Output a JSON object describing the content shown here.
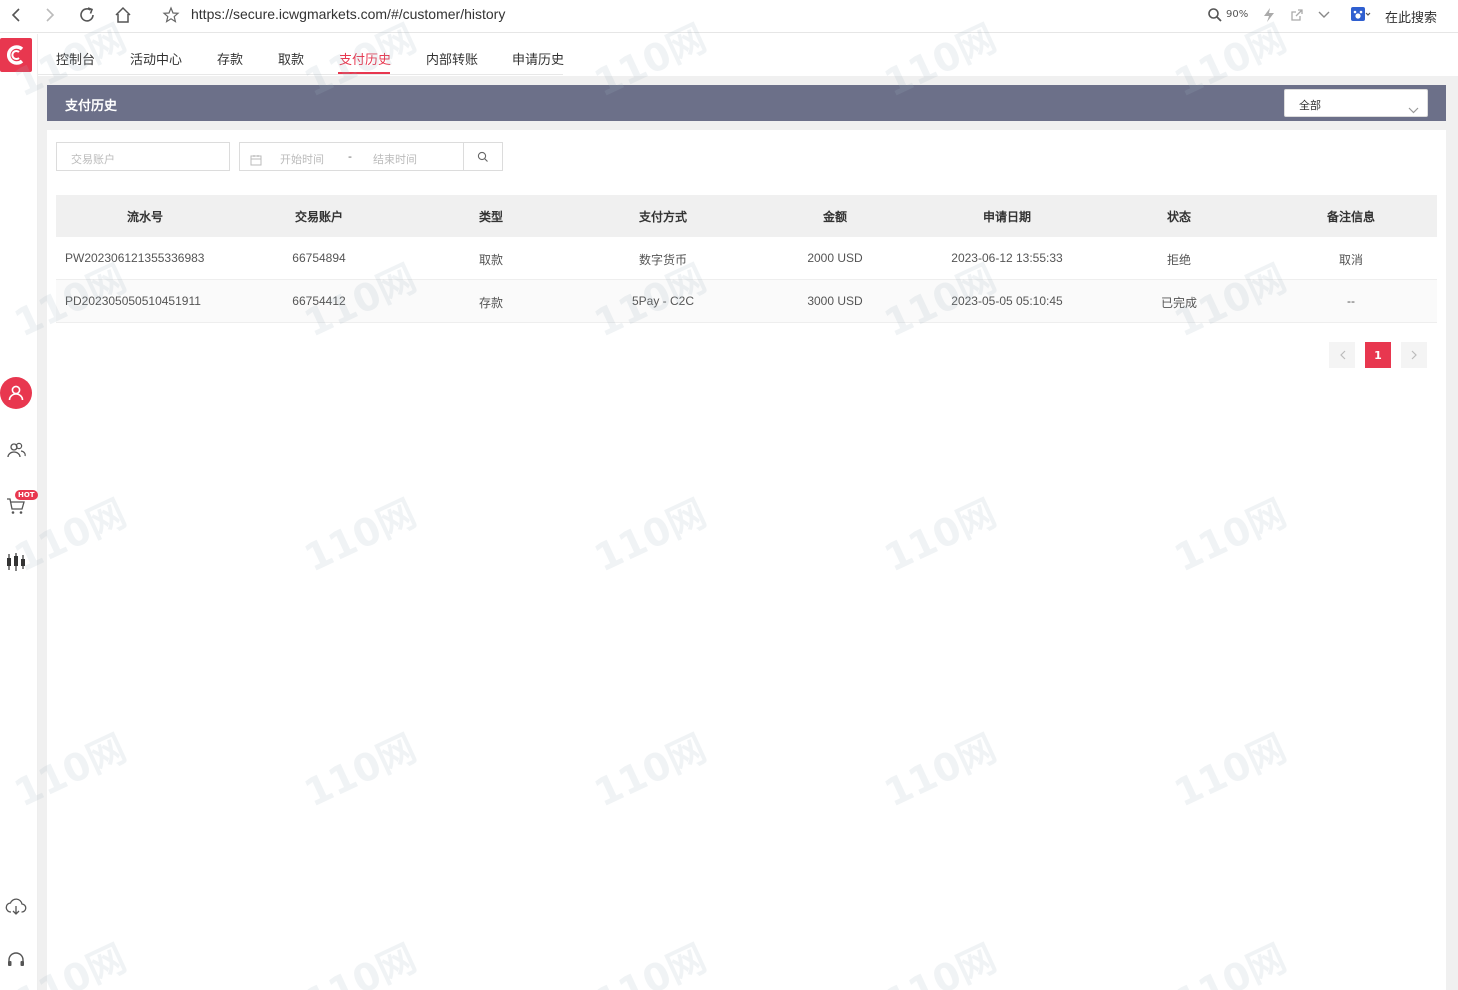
{
  "browser": {
    "url": "https://secure.icwgmarkets.com/#/customer/history",
    "zoom": "90%",
    "search_label": "在此搜索"
  },
  "nav": {
    "tabs": [
      {
        "label": "控制台"
      },
      {
        "label": "活动中心"
      },
      {
        "label": "存款"
      },
      {
        "label": "取款"
      },
      {
        "label": "支付历史"
      },
      {
        "label": "内部转账"
      },
      {
        "label": "申请历史"
      }
    ],
    "active_index": 4
  },
  "sidebar": {
    "hot_badge": "HOT"
  },
  "panel": {
    "title": "支付历史",
    "filter_select": "全部"
  },
  "filters": {
    "account_placeholder": "交易账户",
    "start_placeholder": "开始时间",
    "separator": "-",
    "end_placeholder": "结束时间"
  },
  "table": {
    "headers": [
      "流水号",
      "交易账户",
      "类型",
      "支付方式",
      "金额",
      "申请日期",
      "状态",
      "备注信息"
    ],
    "rows": [
      [
        "PW202306121355336983",
        "66754894",
        "取款",
        "数字货币",
        "2000 USD",
        "2023-06-12 13:55:33",
        "拒绝",
        "取消"
      ],
      [
        "PD202305050510451911",
        "66754412",
        "存款",
        "5Pay - C2C",
        "3000 USD",
        "2023-05-05 05:10:45",
        "已完成",
        "--"
      ]
    ]
  },
  "pagination": {
    "current": "1"
  },
  "colors": {
    "accent": "#e8374f",
    "header_bar": "#6c7089",
    "table_header": "#f0f0f0"
  },
  "watermark": "110网"
}
